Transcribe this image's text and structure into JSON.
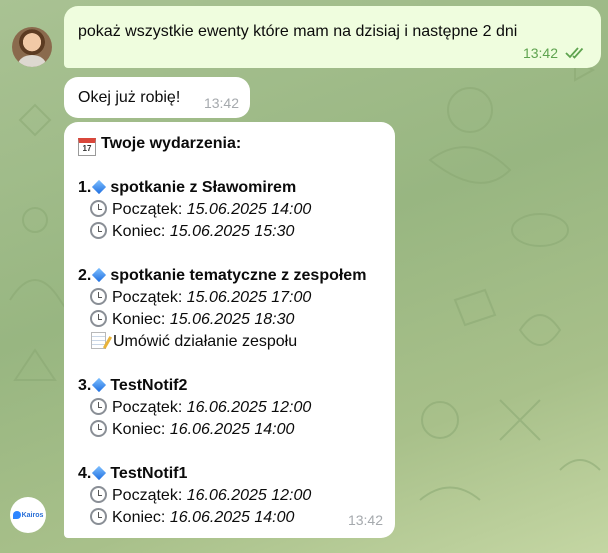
{
  "colors": {
    "outgoing_bubble": "#effdde",
    "incoming_bubble": "#ffffff",
    "read_checks": "#5ea34f",
    "background": "#9bb885"
  },
  "messages": {
    "outgoing": {
      "text": "pokaż wszystkie ewenty które mam na dzisiaj i następne 2 dni",
      "time": "13:42",
      "status_icon": "double-check-icon"
    },
    "reply_short": {
      "text": "Okej już robię!",
      "time": "13:42"
    },
    "events_reply": {
      "header_icon": "calendar-icon",
      "header": "Twoje wydarzenia:",
      "time": "13:42",
      "events": [
        {
          "number": "1.",
          "title": "spotkanie z Sławomirem",
          "start_label": "Początek:",
          "start": "15.06.2025 14:00",
          "end_label": "Koniec:",
          "end": "15.06.2025 15:30"
        },
        {
          "number": "2.",
          "title": "spotkanie tematyczne z zespołem",
          "start_label": "Początek:",
          "start": "15.06.2025 17:00",
          "end_label": "Koniec:",
          "end": "15.06.2025 18:30",
          "note": "Umówić działanie zespołu"
        },
        {
          "number": "3.",
          "title": "TestNotif2",
          "start_label": "Początek:",
          "start": "16.06.2025 12:00",
          "end_label": "Koniec:",
          "end": "16.06.2025 14:00"
        },
        {
          "number": "4.",
          "title": "TestNotif1",
          "start_label": "Początek:",
          "start": "16.06.2025 12:00",
          "end_label": "Koniec:",
          "end": "16.06.2025 14:00"
        }
      ]
    }
  },
  "bot": {
    "avatar_text": "Kairos"
  }
}
